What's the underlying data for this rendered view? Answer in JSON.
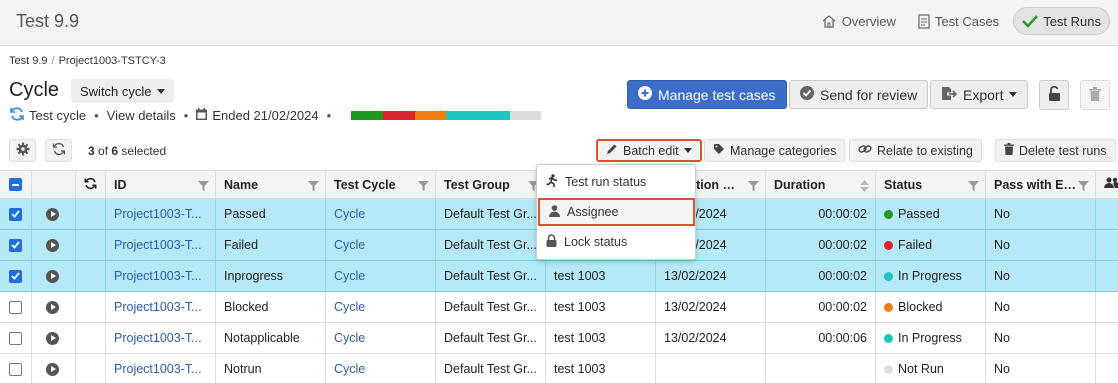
{
  "app": {
    "title": "Test 9.9"
  },
  "topnav": [
    {
      "label": "Overview",
      "icon": "home-icon"
    },
    {
      "label": "Test Cases",
      "icon": "document-icon"
    },
    {
      "label": "Test Runs",
      "icon": "checkmark-icon",
      "active": true
    }
  ],
  "breadcrumb": [
    "Test 9.9",
    "Project1003-TSTCY-3"
  ],
  "page": {
    "title": "Cycle",
    "switch_label": "Switch cycle",
    "type_label": "Test cycle",
    "view_details": "View details",
    "ended": "Ended 21/02/2024",
    "progress_colors": [
      "#1e9a1e",
      "#dc2430",
      "#f07c12",
      "#1fc3bf",
      "#dcdcdc"
    ],
    "progress_fractions": [
      0.1667,
      0.1667,
      0.1667,
      0.3333,
      0.1667
    ]
  },
  "actions": {
    "manage_test_cases": "Manage test cases",
    "send_for_review": "Send for review",
    "export": "Export"
  },
  "toolbar": {
    "selected_count": "3",
    "of": "of",
    "total": "6",
    "selected_suffix": "selected",
    "batch_edit": "Batch edit",
    "manage_categories": "Manage categories",
    "relate_to_existing": "Relate to existing",
    "delete_test_runs": "Delete test runs"
  },
  "batch_menu": {
    "items": [
      "Test run status",
      "Assignee",
      "Lock status"
    ],
    "highlighted": "Assignee"
  },
  "table": {
    "columns": [
      "ID",
      "Name",
      "Test Cycle",
      "Test Group",
      "…ution …",
      "Duration",
      "Status",
      "Pass with E…"
    ],
    "rows": [
      {
        "selected": true,
        "id": "Project1003-T...",
        "name": "Passed",
        "cycle": "Cycle",
        "group": "Default Test Gr...",
        "assignee": "",
        "date": "13/02/2024",
        "duration": "00:00:02",
        "status": "Passed",
        "status_color": "#1e9a1e",
        "pass_with": "No"
      },
      {
        "selected": true,
        "id": "Project1003-T...",
        "name": "Failed",
        "cycle": "Cycle",
        "group": "Default Test Gr...",
        "assignee": "",
        "date": "13/02/2024",
        "duration": "00:00:02",
        "status": "Failed",
        "status_color": "#dc2430",
        "pass_with": "No"
      },
      {
        "selected": true,
        "id": "Project1003-T...",
        "name": "Inprogress",
        "cycle": "Cycle",
        "group": "Default Test Gr...",
        "assignee": "test 1003",
        "date": "13/02/2024",
        "duration": "00:00:02",
        "status": "In Progress",
        "status_color": "#1fc3bf",
        "pass_with": "No"
      },
      {
        "selected": false,
        "id": "Project1003-T...",
        "name": "Blocked",
        "cycle": "Cycle",
        "group": "Default Test Gr...",
        "assignee": "test 1003",
        "date": "13/02/2024",
        "duration": "00:00:02",
        "status": "Blocked",
        "status_color": "#f07c12",
        "pass_with": "No"
      },
      {
        "selected": false,
        "id": "Project1003-T...",
        "name": "Notapplicable",
        "cycle": "Cycle",
        "group": "Default Test Gr...",
        "assignee": "test 1003",
        "date": "13/02/2024",
        "duration": "00:00:06",
        "status": "In Progress",
        "status_color": "#1fc3bf",
        "pass_with": "No"
      },
      {
        "selected": false,
        "id": "Project1003-T...",
        "name": "Notrun",
        "cycle": "Cycle",
        "group": "Default Test Gr...",
        "assignee": "test 1003",
        "date": "",
        "duration": "",
        "status": "Not Run",
        "status_color": "#dcdcdc",
        "pass_with": "No"
      }
    ]
  }
}
